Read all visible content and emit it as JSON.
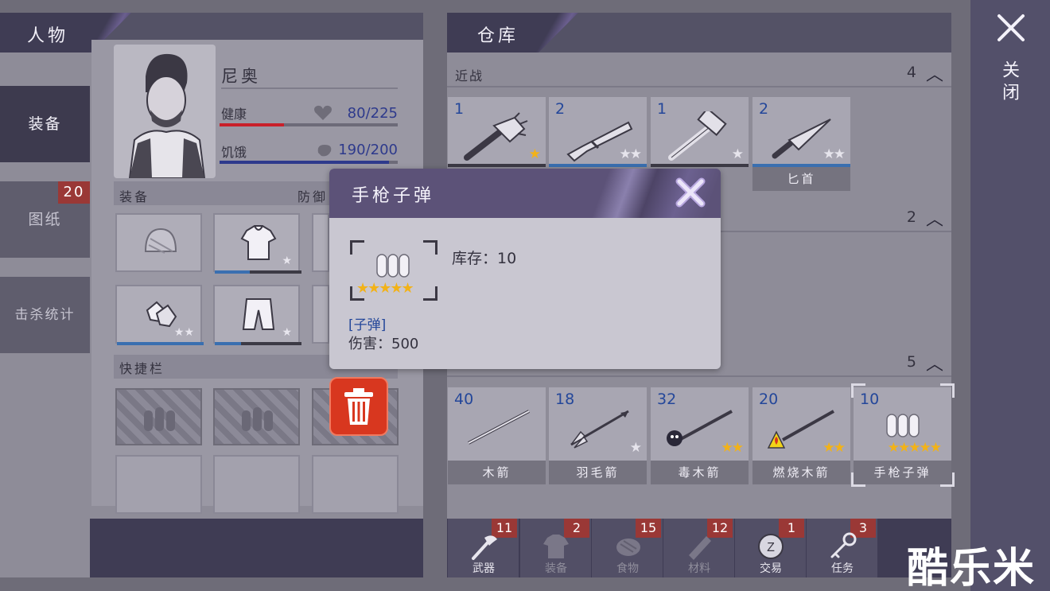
{
  "left": {
    "header_title": "人物",
    "side_tabs": [
      {
        "label": "装备",
        "active": true,
        "badge": ""
      },
      {
        "label": "图纸",
        "active": false,
        "badge": "20"
      },
      {
        "label": "击杀统计",
        "active": false,
        "badge": ""
      }
    ],
    "character": {
      "name": "尼奥",
      "health_label": "健康",
      "health_value": "80/225",
      "health_fraction": 0.36,
      "hunger_label": "饥饿",
      "hunger_value": "190/200",
      "hunger_fraction": 0.95
    },
    "equip_label": "装备",
    "defense_label": "防御",
    "quickbar_label": "快捷栏"
  },
  "right": {
    "header_title": "仓库",
    "categories": [
      {
        "label": "近战",
        "count": "4"
      },
      {
        "label": "",
        "count": "2"
      },
      {
        "label": "",
        "count": "5"
      }
    ],
    "melee_items": [
      {
        "count": "1",
        "name": "",
        "stars": 1,
        "star_color": "gold",
        "durability": 1.0
      },
      {
        "count": "2",
        "name": "",
        "stars": 2,
        "star_color": "grey",
        "durability": 1.0
      },
      {
        "count": "1",
        "name": "",
        "stars": 1,
        "star_color": "grey",
        "durability": 1.0
      },
      {
        "count": "2",
        "name": "匕首",
        "stars": 2,
        "star_color": "grey",
        "durability": 1.0
      }
    ],
    "ammo_items": [
      {
        "count": "40",
        "name": "木箭",
        "stars": 0
      },
      {
        "count": "18",
        "name": "羽毛箭",
        "stars": 1,
        "star_color": "grey"
      },
      {
        "count": "32",
        "name": "毒木箭",
        "stars": 2,
        "star_color": "gold"
      },
      {
        "count": "20",
        "name": "燃烧木箭",
        "stars": 2,
        "star_color": "gold"
      },
      {
        "count": "10",
        "name": "手枪子弹",
        "stars": 5,
        "star_color": "gold"
      }
    ],
    "bottom_tabs": [
      {
        "label": "武器",
        "badge": "11",
        "active": true
      },
      {
        "label": "装备",
        "badge": "2",
        "active": false
      },
      {
        "label": "食物",
        "badge": "15",
        "active": false
      },
      {
        "label": "材料",
        "badge": "12",
        "active": false
      },
      {
        "label": "交易",
        "badge": "1",
        "active": true
      },
      {
        "label": "任务",
        "badge": "3",
        "active": true
      }
    ]
  },
  "close_label": "关闭",
  "watermark": "酷乐米",
  "popup": {
    "title": "手枪子弹",
    "stock": "库存：10",
    "type": "[子弹]",
    "damage": "伤害：500",
    "stars": 5
  },
  "icons": {
    "close": "close-x-icon",
    "trash": "trash-icon",
    "popup_close": "purple-x-icon"
  },
  "colors": {
    "header": "#3f3c54",
    "badge": "#9a3836",
    "health_bar": "#c9202a",
    "hunger_bar": "#2e3a8c",
    "star_gold": "#f2b218",
    "count_blue": "#24479a",
    "trash": "#d8371f"
  }
}
